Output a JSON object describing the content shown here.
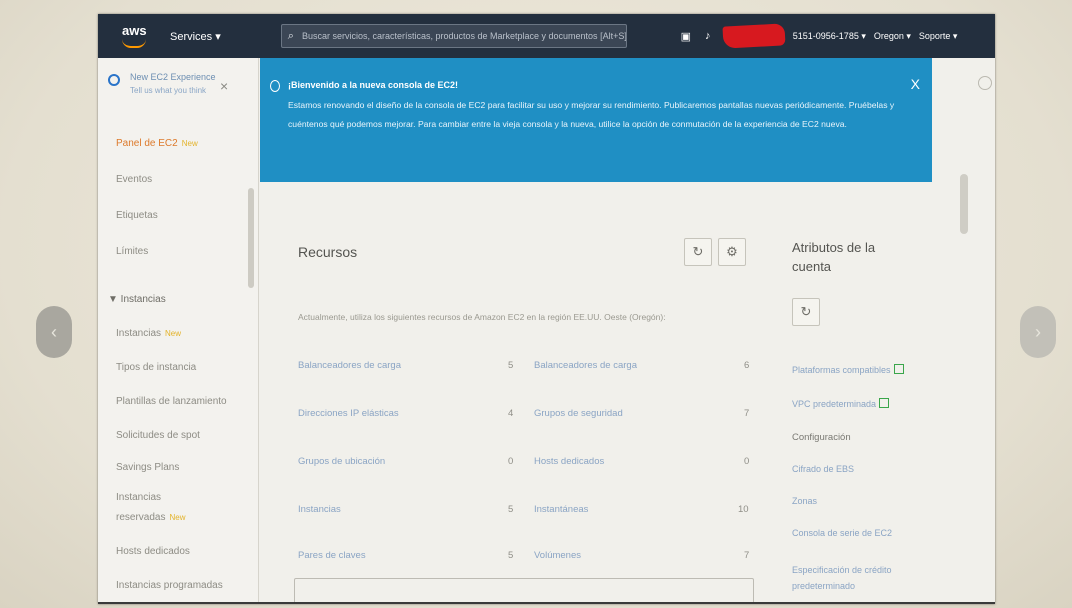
{
  "nav": {
    "logo": "aws",
    "services": "Services ▾",
    "search_placeholder": "Buscar servicios, características, productos de Marketplace y documentos   [Alt+S]",
    "account": "5151-0956-1785 ▾",
    "region": "Oregon ▾",
    "support": "Soporte ▾"
  },
  "sidebar": {
    "title": "New EC2 Experience",
    "subtitle": "Tell us what you think",
    "items_top": [
      "Panel de EC2",
      "Eventos",
      "Etiquetas",
      "Límites"
    ],
    "new_badge": "New",
    "section": "▼ Instancias",
    "instances": [
      "Instancias",
      "Tipos de instancia",
      "Plantillas de lanzamiento",
      "Solicitudes de spot",
      "Savings Plans",
      "Instancias",
      "reservadas",
      "Hosts dedicados",
      "Instancias programadas"
    ]
  },
  "banner": {
    "title": "¡Bienvenido a la nueva consola de EC2!",
    "text": "Estamos renovando el diseño de la consola de EC2 para facilitar su uso y mejorar su rendimiento. Publicaremos pantallas nuevas periódicamente. Pruébelas y cuéntenos qué podemos mejorar. Para cambiar entre la vieja consola y la nueva, utilice la opción de conmutación de la experiencia de EC2 nueva.",
    "close": "X"
  },
  "resources": {
    "title": "Recursos",
    "refresh_icon": "refresh-icon",
    "settings_icon": "gear-icon",
    "description": "Actualmente, utiliza los siguientes recursos de Amazon EC2 en la región EE.UU. Oeste (Oregón):",
    "left": [
      {
        "label": "Balanceadores de carga",
        "value": "5"
      },
      {
        "label": "Direcciones IP elásticas",
        "value": "4"
      },
      {
        "label": "Grupos de ubicación",
        "value": "0"
      },
      {
        "label": "Instancias",
        "value": "5"
      },
      {
        "label": "Pares de claves",
        "value": "5"
      }
    ],
    "right": [
      {
        "label": "Balanceadores de carga",
        "value": "6"
      },
      {
        "label": "Grupos de seguridad",
        "value": "7"
      },
      {
        "label": "Hosts dedicados",
        "value": "0"
      },
      {
        "label": "Instantáneas",
        "value": "10"
      },
      {
        "label": "Volúmenes",
        "value": "7"
      }
    ]
  },
  "attributes": {
    "title": "Atributos de la cuenta",
    "links": [
      "Plataformas compatibles",
      "VPC predeterminada"
    ],
    "config_label": "Configuración",
    "config_items": [
      "Cifrado de EBS",
      "Zonas",
      "Consola de serie de EC2",
      "Especificación de crédito predeterminado"
    ]
  }
}
